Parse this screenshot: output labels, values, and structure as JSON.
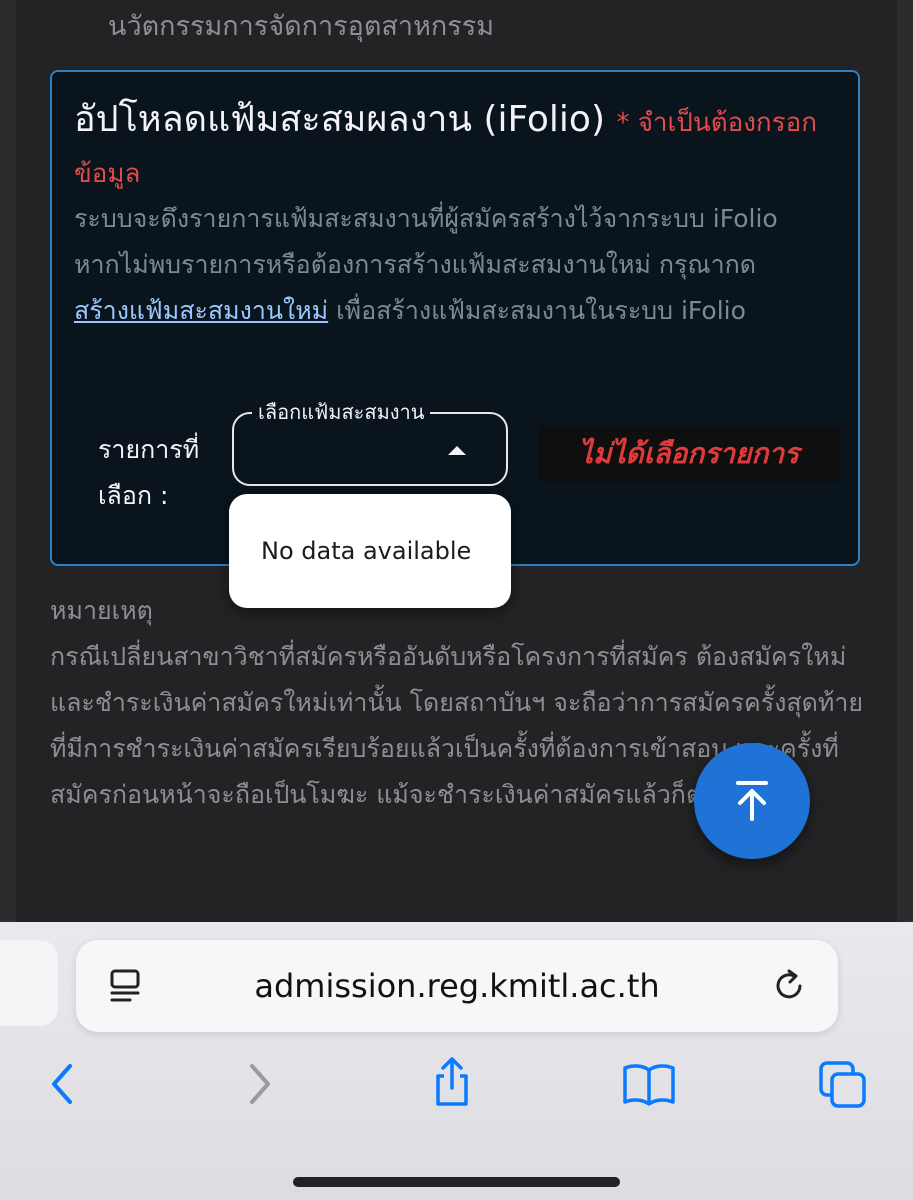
{
  "page": {
    "previous_line": "นวัตกรรมการจัดการอุตสาหกรรม"
  },
  "card": {
    "title": "อัปโหลดแฟ้มสะสมผลงาน (iFolio)",
    "required_note": "* จำเป็นต้องกรอกข้อมูล",
    "description_before_link": "ระบบจะดึงรายการแฟ้มสะสมงานที่ผู้สมัครสร้างไว้จากระบบ iFolio หากไม่พบรายการหรือต้องการสร้างแฟ้มสะสมงานใหม่ กรุณากด",
    "link_text": "สร้างแฟ้มสะสมงานใหม่",
    "description_after_link": "เพื่อสร้างแฟ้มสะสมงานในระบบ iFolio",
    "selected_label": "รายการที่เลือก :",
    "select_legend": "เลือกแฟ้มสะสมงาน",
    "status_text": "ไม่ได้เลือกรายการ",
    "dropdown_empty_text": "No data available"
  },
  "note": {
    "heading": "หมายเหตุ",
    "body": "กรณีเปลี่ยนสาขาวิชาที่สมัครหรืออันดับหรือโครงการที่สมัคร ต้องสมัครใหม่ และชำระเงินค่าสมัครใหม่เท่านั้น โดยสถาบันฯ จะถือว่าการสมัครครั้งสุดท้ายที่มีการชำระเงินค่าสมัครเรียบร้อยแล้วเป็นครั้งที่ต้องการเข้าสอบ และครั้งที่สมัครก่อนหน้าจะถือเป็นโมฆะ แม้จะชำระเงินค่าสมัครแล้วก็ตาม"
  },
  "fab": {
    "icon": "arrow-up-to-top-icon"
  },
  "browser": {
    "url": "admission.reg.kmitl.ac.th",
    "icons": {
      "reader": "reader-mode-icon",
      "reload": "reload-icon",
      "back": "back-chevron-icon",
      "forward": "forward-chevron-icon",
      "share": "share-icon",
      "bookmarks": "bookmarks-book-icon",
      "tabs": "tabs-icon"
    },
    "colors": {
      "accent": "#0a7aff",
      "disabled": "#9a9a9e"
    }
  }
}
